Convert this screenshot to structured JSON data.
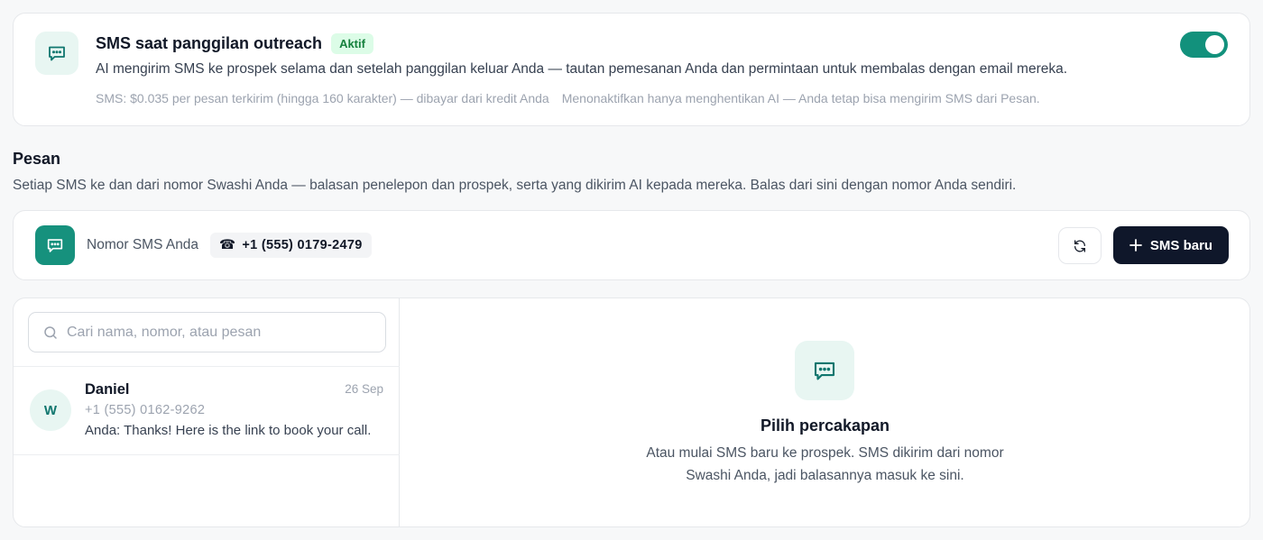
{
  "outreach": {
    "title": "SMS saat panggilan outreach",
    "badge": "Aktif",
    "description": "AI mengirim SMS ke prospek selama dan setelah panggilan keluar Anda — tautan pemesanan Anda dan permintaan untuk membalas dengan email mereka.",
    "pricing_note": "SMS: $0.035 per pesan terkirim (hingga 160 karakter) — dibayar dari kredit Anda",
    "disable_note": "Menonaktifkan hanya menghentikan AI — Anda tetap bisa mengirim SMS dari Pesan.",
    "toggle_on": true,
    "icon": "chat-bubble-icon",
    "accent_color": "#12917c"
  },
  "messages_section": {
    "title": "Pesan",
    "description": "Setiap SMS ke dan dari nomor Swashi Anda — balasan penelepon dan prospek, serta yang dikirim AI kepada mereka. Balas dari sini dengan nomor Anda sendiri."
  },
  "number_bar": {
    "label": "Nomor SMS Anda",
    "phone_icon": "☎",
    "phone_number": "+1 (555) 0179-2479",
    "refresh_icon": "refresh-icon",
    "new_sms_label": "SMS baru"
  },
  "search": {
    "placeholder": "Cari nama, nomor, atau pesan",
    "value": ""
  },
  "conversations": [
    {
      "initial": "W",
      "name": "Daniel",
      "date": "26 Sep",
      "phone": "+1 (555) 0162-9262",
      "preview": "Anda: Thanks! Here is the link to book your call."
    }
  ],
  "empty_state": {
    "title": "Pilih percakapan",
    "description": "Atau mulai SMS baru ke prospek. SMS dikirim dari nomor Swashi Anda, jadi balasannya masuk ke sini."
  }
}
